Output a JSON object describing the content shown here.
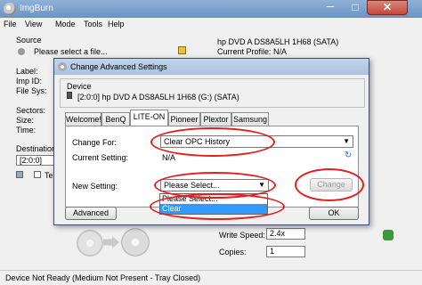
{
  "app": {
    "title": "ImgBurn"
  },
  "window_controls": {
    "minimize": "─",
    "maximize": "□",
    "close": "✕"
  },
  "menu": [
    "File",
    "View",
    "Mode",
    "Tools",
    "Help"
  ],
  "source": {
    "group_label": "Source",
    "select_placeholder": "Please select a file...",
    "drive_text": "hp DVD A  DS8A5LH 1H68 (SATA)",
    "profile_text": "Current Profile: N/A"
  },
  "info_labels": [
    "Label:",
    "Imp ID:",
    "File Sys:",
    "Sectors:",
    "Size:",
    "Time:"
  ],
  "destination": {
    "group_label": "Destination",
    "drive_value": "[2:0:0]",
    "test_mode_label": "Te"
  },
  "write_speed": {
    "label": "Write Speed:",
    "value": "2.4x"
  },
  "copies": {
    "label": "Copies:",
    "value": "1"
  },
  "dialog": {
    "title": "Change Advanced Settings",
    "device_label": "Device",
    "device_value": "[2:0:0] hp DVD A  DS8A5LH 1H68 (G:) (SATA)",
    "tabs": [
      "Welcome!",
      "BenQ",
      "LITE-ON",
      "Pioneer",
      "Plextor",
      "Samsung"
    ],
    "active_tab": "LITE-ON",
    "change_for_label": "Change For:",
    "change_for_value": "Clear OPC History",
    "current_setting_label": "Current Setting:",
    "current_setting_value": "N/A",
    "new_setting_label": "New Setting:",
    "new_setting_value": "Please Select...",
    "dropdown_options": [
      "Please Select...",
      "Clear"
    ],
    "highlighted_option": "Clear",
    "change_button": "Change",
    "advanced_button": "Advanced",
    "ok_button": "OK"
  },
  "status_bar": "Device Not Ready (Medium Not Present - Tray Closed)",
  "colors": {
    "annotation": "#e02020",
    "selection": "#3399ff"
  }
}
